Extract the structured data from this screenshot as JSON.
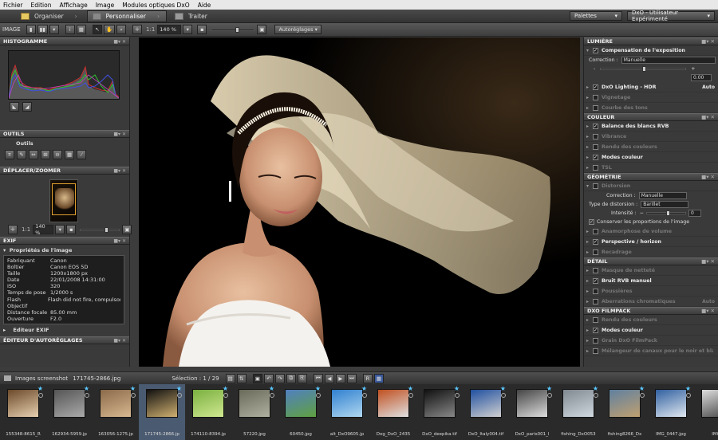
{
  "menu": [
    "Fichier",
    "Edition",
    "Affichage",
    "Image",
    "Modules optiques DxO",
    "Aide"
  ],
  "steps": [
    {
      "label": "Organiser"
    },
    {
      "label": "Personnaliser"
    },
    {
      "label": "Traiter"
    }
  ],
  "header_right": {
    "palettes": "Palettes",
    "mode": "DxO - Utilisateur Expérimenté"
  },
  "toolbar": {
    "image_label": "IMAGE",
    "ratio": "1:1",
    "zoom": "140 %",
    "preset": "Autoréglages"
  },
  "left": {
    "histogram_title": "HISTOGRAMME",
    "tools_title": "OUTILS",
    "tools_sub": "Outils",
    "move_title": "DÉPLACER/ZOOMER",
    "move_ratio": "1:1",
    "move_zoom": "140 %",
    "exif_title": "EXIF",
    "exif_sub": "Propriétés de l'image",
    "exif_rows": [
      {
        "k": "Fabriquant",
        "v": "Canon"
      },
      {
        "k": "Boîtier",
        "v": "Canon EOS 5D"
      },
      {
        "k": "Taille",
        "v": "1200x1800 px"
      },
      {
        "k": "Date",
        "v": "22/01/2008 14:31:00"
      },
      {
        "k": "ISO",
        "v": "320"
      },
      {
        "k": "Temps de pose",
        "v": "1/2000 s"
      },
      {
        "k": "Flash",
        "v": "Flash did not fire, compulsory"
      },
      {
        "k": "Objectif",
        "v": ""
      },
      {
        "k": "Distance focale",
        "v": "85.00 mm"
      },
      {
        "k": "Ouverture",
        "v": "F2.0"
      }
    ],
    "exif_editor": "Editeur EXIF",
    "autoreg_title": "ÉDITEUR D'AUTORÉGLAGES"
  },
  "right": {
    "lumiere": "LUMIÈRE",
    "exposure": "Compensation de l'exposition",
    "correction_label": "Correction :",
    "correction_val": "Manuelle",
    "exp_minus": "-",
    "exp_plus": "+",
    "exp_val": "0.00",
    "lighting": "DxO Lighting - HDR",
    "lighting_auto": "Auto",
    "vignetage": "Vignetage",
    "courbe": "Courbe des tons",
    "couleur": "COULEUR",
    "balance": "Balance des blancs RVB",
    "vibrance": "Vibrance",
    "rendu": "Rendu des couleurs",
    "modes": "Modes couleur",
    "tsl": "TSL",
    "geometrie": "GÉOMÉTRIE",
    "distorsion": "Distorsion",
    "geo_corr_label": "Correction :",
    "geo_corr_val": "Manuelle",
    "type_label": "Type de distorsion :",
    "type_val": "Barillet",
    "intensite_label": "Intensité :",
    "intensite_minus": "−",
    "intensite_val": "0",
    "conserver": "Conserver les proportions de l'image",
    "anamorphose": "Anamorphose de volume",
    "perspective": "Perspective / horizon",
    "recadrage": "Recadrage",
    "detail": "DÉTAIL",
    "masque": "Masque de netteté",
    "bruit": "Bruit RVB manuel",
    "poussieres": "Poussières",
    "aberrations": "Aberrations chromatiques",
    "aberr_auto": "Auto",
    "filmpack": "DXO FILMPACK",
    "fp_rendu": "Rendu des couleurs",
    "fp_modes": "Modes couleur",
    "fp_grain": "Grain DxO FilmPack",
    "fp_melangeur": "Mélangeur de canaux pour le noir et blanc"
  },
  "status": {
    "folder": "Images screenshot",
    "file": "171745-2866.jpg",
    "selection": "Sélection : 1 / 29"
  },
  "thumbs": [
    {
      "name": "155348-8615_R",
      "c1": "#6b4a2a",
      "c2": "#e8d0b0"
    },
    {
      "name": "162934-5959.jp",
      "c1": "#555",
      "c2": "#aaa"
    },
    {
      "name": "163056-1275.jp",
      "c1": "#8a6a4a",
      "c2": "#d8b890"
    },
    {
      "name": "171745-2866.jp",
      "c1": "#111",
      "c2": "#d0b070"
    },
    {
      "name": "174110-8394.jp",
      "c1": "#7ab040",
      "c2": "#d0e890"
    },
    {
      "name": "57220.jpg",
      "c1": "#6a6a5a",
      "c2": "#b0b0a0"
    },
    {
      "name": "60450.jpg",
      "c1": "#5080c0",
      "c2": "#60a040"
    },
    {
      "name": "alt_DxO9605.jp",
      "c1": "#3080d0",
      "c2": "#b0d8f0"
    },
    {
      "name": "Dog_DxO_2435",
      "c1": "#c05020",
      "c2": "#e0e0e0"
    },
    {
      "name": "DxO_deepika.tif",
      "c1": "#111",
      "c2": "#888"
    },
    {
      "name": "DxO_Italy004.tif",
      "c1": "#2050a0",
      "c2": "#d0d0d0"
    },
    {
      "name": "DxO_paris001_l",
      "c1": "#444",
      "c2": "#ddd"
    },
    {
      "name": "fishing_DxO053",
      "c1": "#808890",
      "c2": "#d0d8e0"
    },
    {
      "name": "fishing8266_Dx",
      "c1": "#6080a0",
      "c2": "#c0a070"
    },
    {
      "name": "IMG_0447.jpg",
      "c1": "#3060a0",
      "c2": "#e0e8f0"
    },
    {
      "name": "IMG_",
      "c1": "#ddd",
      "c2": "#444"
    }
  ],
  "colors": {
    "accent_selected": "#4a5a70",
    "star": "#5cc8ff"
  }
}
